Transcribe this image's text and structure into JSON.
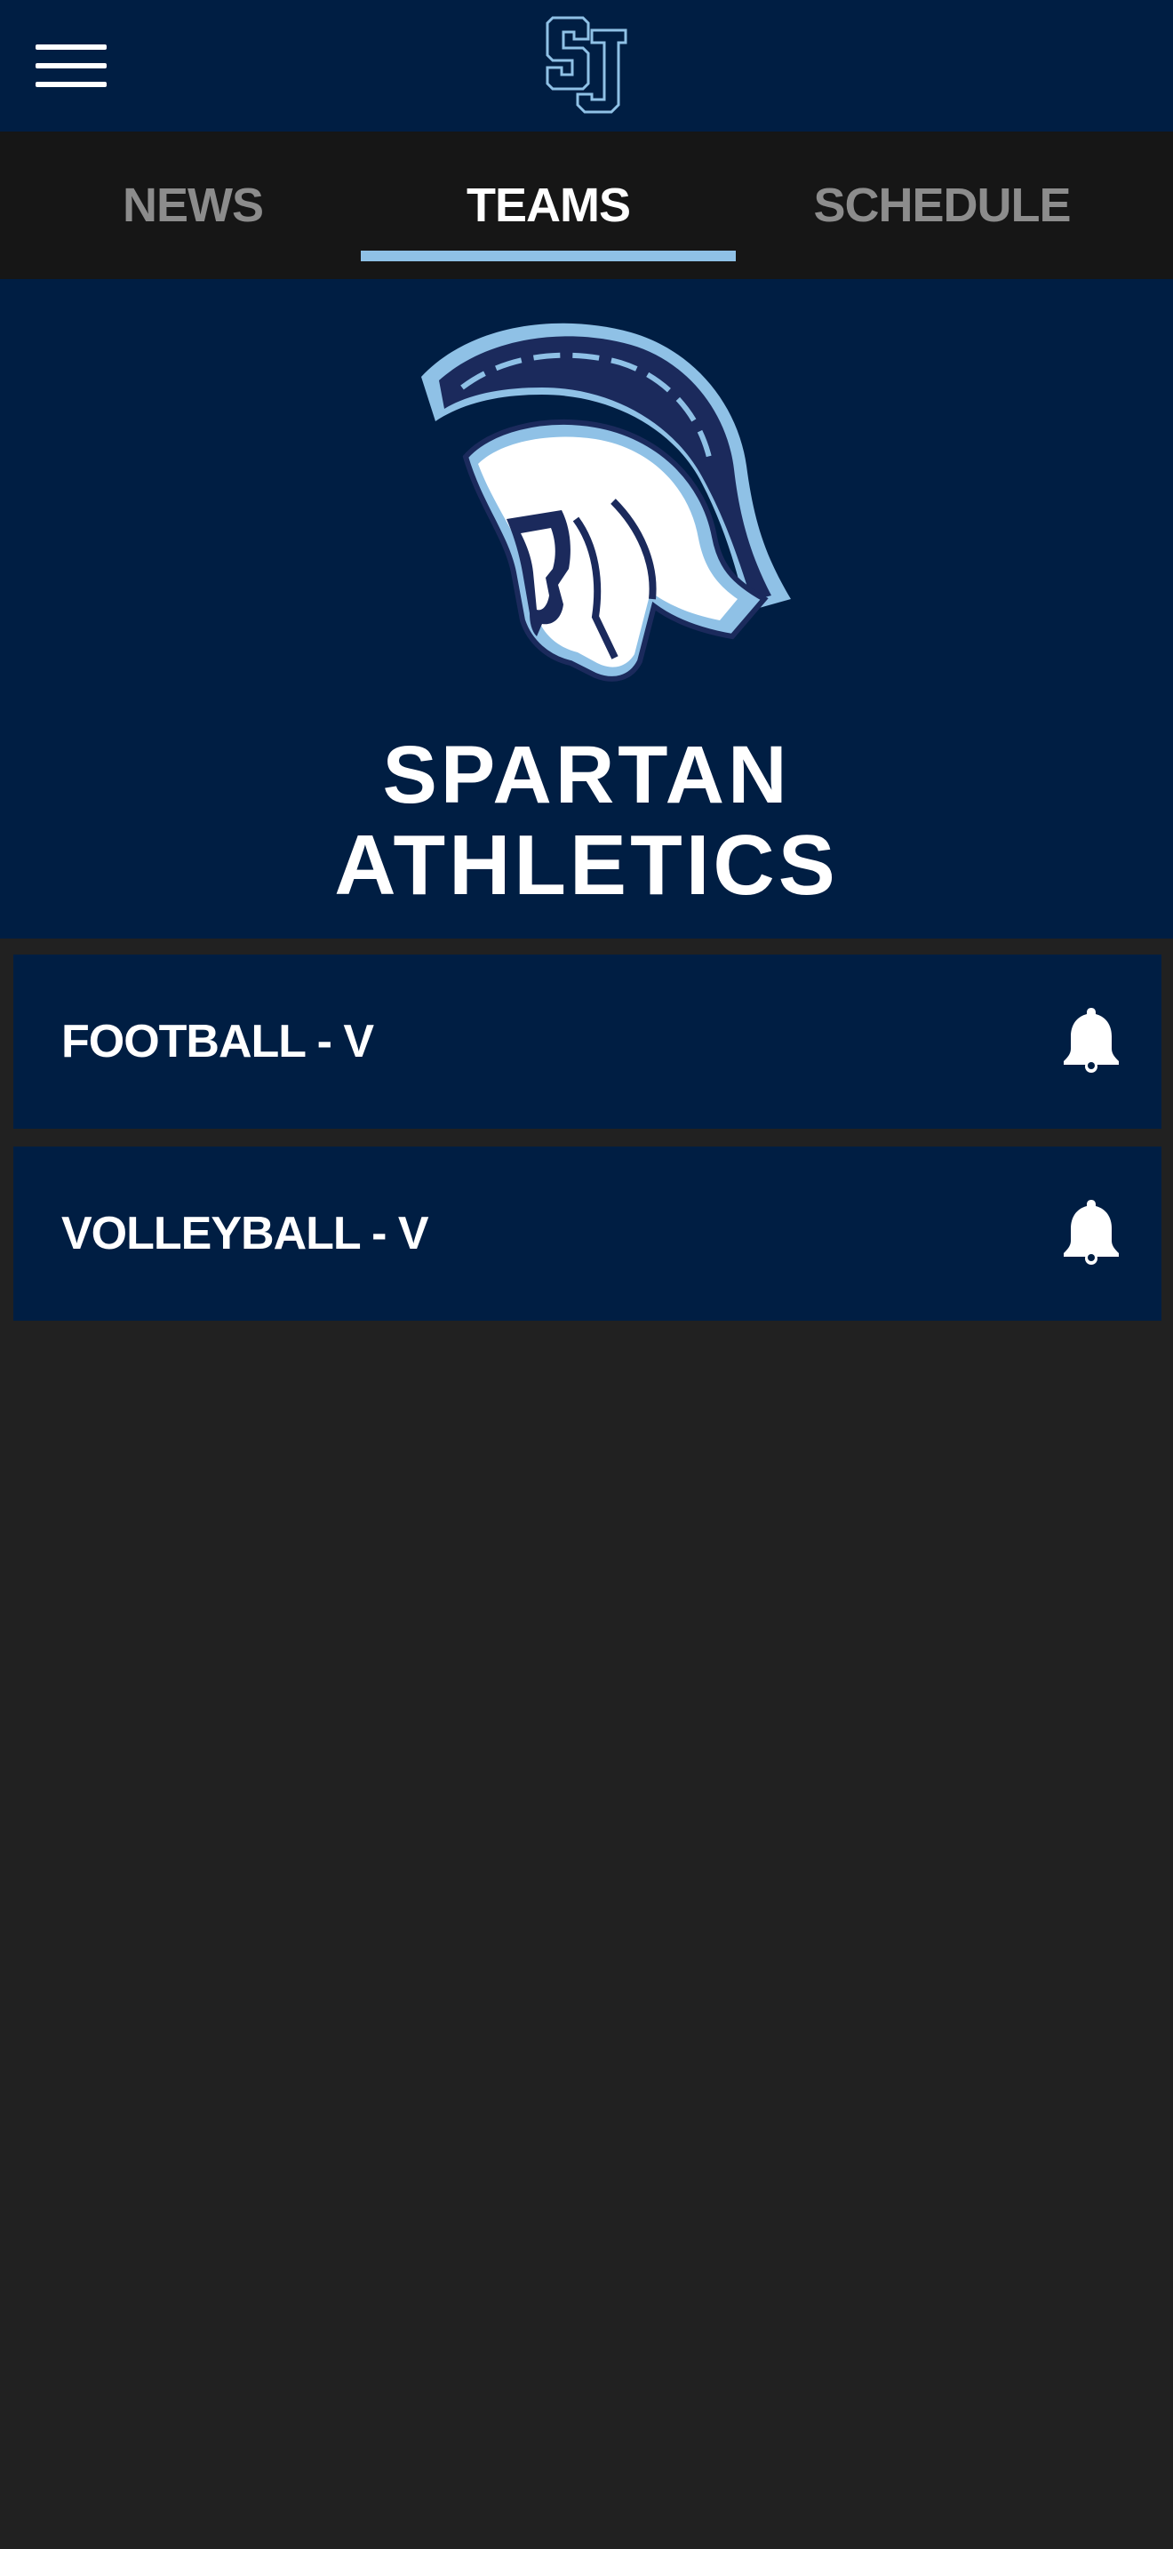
{
  "header": {
    "logo_text": "SJ",
    "menu_icon": "hamburger-menu-icon",
    "brand_color": "#001e43"
  },
  "tabs": [
    {
      "label": "NEWS",
      "active": false
    },
    {
      "label": "TEAMS",
      "active": true
    },
    {
      "label": "SCHEDULE",
      "active": false
    }
  ],
  "tab_indicator_color": "#8fc1e6",
  "banner": {
    "line1": "SPARTAN",
    "line2": "ATHLETICS",
    "logo_icon": "spartan-helmet-icon"
  },
  "teams": [
    {
      "name": "FOOTBALL - V",
      "icon": "bell-icon"
    },
    {
      "name": "VOLLEYBALL - V",
      "icon": "bell-icon"
    }
  ],
  "colors": {
    "background": "#212121",
    "tab_bar": "#161616",
    "helmet_light": "#8fc1e6",
    "helmet_dark": "#1b2a5c"
  }
}
